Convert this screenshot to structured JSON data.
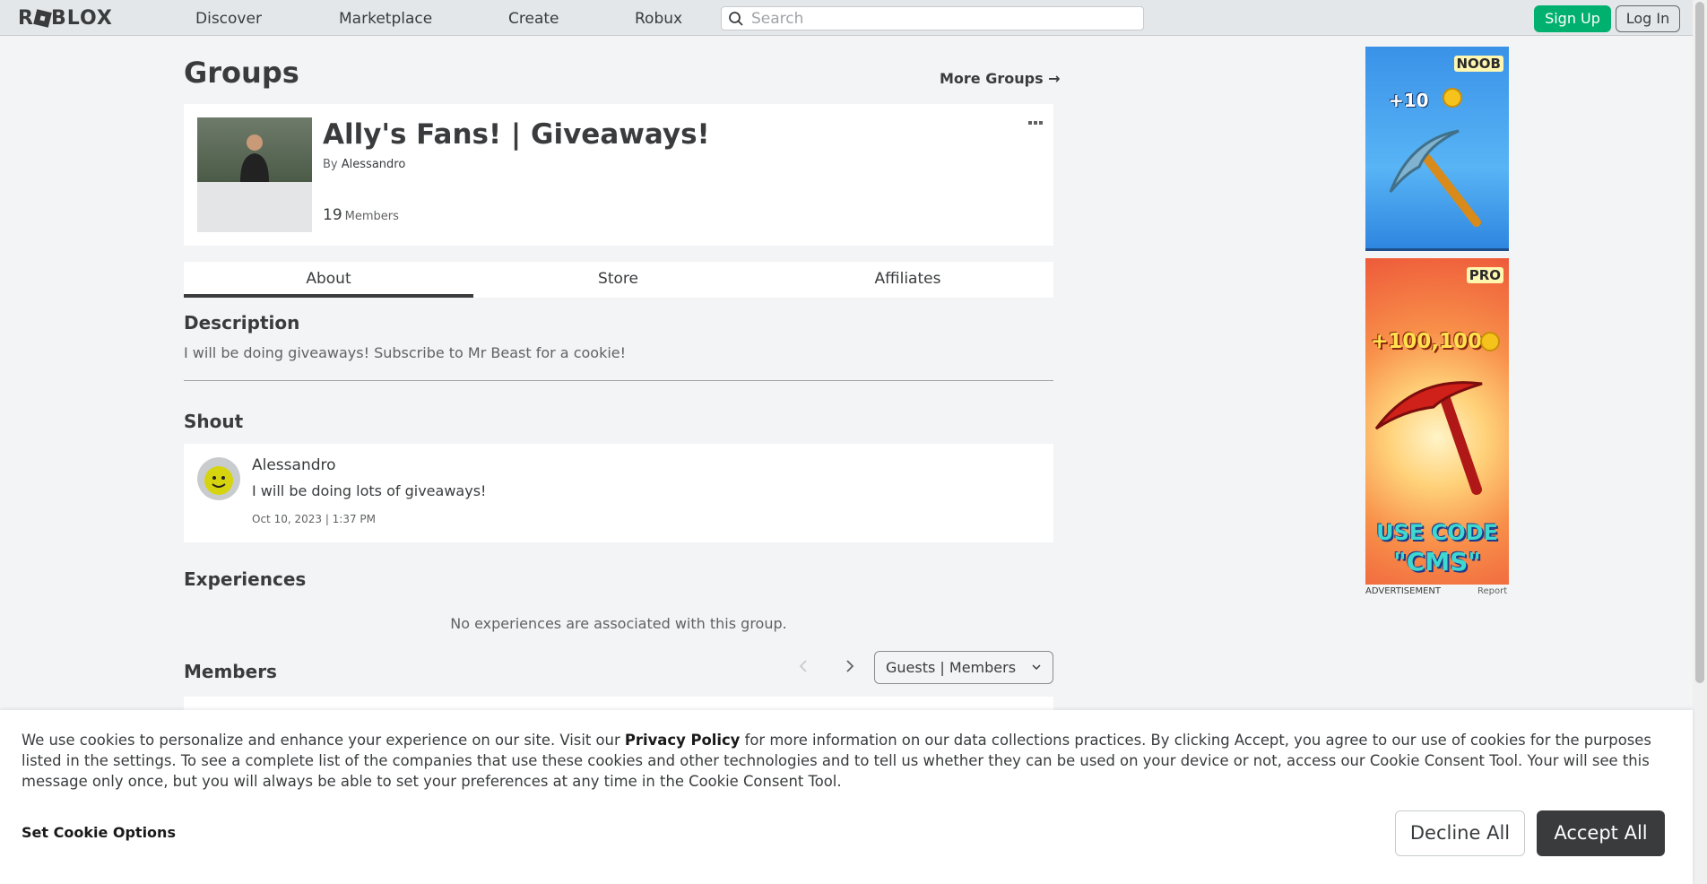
{
  "nav": {
    "logo": "ROBLOX",
    "links": [
      "Discover",
      "Marketplace",
      "Create",
      "Robux"
    ],
    "search_placeholder": "Search",
    "signup_label": "Sign Up",
    "login_label": "Log In"
  },
  "page": {
    "title": "Groups",
    "more_groups": "More Groups →"
  },
  "group": {
    "name": "Ally's Fans! | Giveaways!",
    "by_prefix": "By",
    "owner": "Alessandro",
    "member_count": "19",
    "members_label": "Members",
    "more_icon": "more-dots-icon"
  },
  "tabs": [
    "About",
    "Store",
    "Affiliates"
  ],
  "about": {
    "description_heading": "Description",
    "description_text": "I will be doing giveaways! Subscribe to Mr Beast for a cookie!",
    "shout_heading": "Shout",
    "shout": {
      "author": "Alessandro",
      "body": "I will be doing lots of giveaways!",
      "timestamp": "Oct 10, 2023 | 1:37 PM"
    },
    "experiences_heading": "Experiences",
    "no_experiences": "No experiences are associated with this group.",
    "members_heading": "Members",
    "role_select": "Guests | Members"
  },
  "ads": {
    "ad1_badge": "NOOB",
    "ad1_amount": "+10",
    "ad2_badge": "PRO",
    "ad2_amount": "+100,100",
    "ad2_code_line1": "USE CODE",
    "ad2_code_line2": "\"CMS\"",
    "label": "ADVERTISEMENT",
    "report": "Report"
  },
  "cookie": {
    "text_before": "We use cookies to personalize and enhance your experience on our site. Visit our ",
    "privacy_link": "Privacy Policy",
    "text_after": " for more information on our data collections practices. By clicking Accept, you agree to our use of cookies for the purposes listed in the settings. To see a complete list of the companies that use these cookies and other technologies and to tell us whether they can be used on your device or not, access our Cookie Consent Tool. Your will see this message only once, but you will always be able to set your preferences at any time in the Cookie Consent Tool.",
    "set_options": "Set Cookie Options",
    "decline": "Decline All",
    "accept": "Accept All"
  },
  "colors": {
    "signup_green": "#00b06f",
    "accept_dark": "#393b3d",
    "page_bg": "#f2f4f5"
  }
}
